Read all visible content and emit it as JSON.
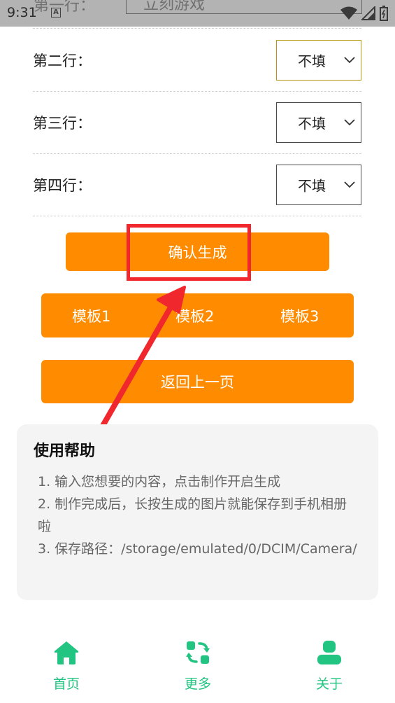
{
  "status_bar": {
    "time": "9:31",
    "notification_glyph": "A"
  },
  "background_row": {
    "label_fragment": "第一行：",
    "value_fragment": "立刻游戏"
  },
  "form": {
    "rows": [
      {
        "label": "第二行：",
        "value": "不填"
      },
      {
        "label": "第三行：",
        "value": "不填"
      },
      {
        "label": "第四行：",
        "value": "不填"
      }
    ]
  },
  "actions": {
    "confirm_label": "确认生成",
    "templates": [
      "模板1",
      "模板2",
      "模板3"
    ],
    "back_label": "返回上一页"
  },
  "help": {
    "title": "使用帮助",
    "items": [
      "1. 输入您想要的内容，点击制作开启生成",
      "2. 制作完成后，长按生成的图片就能保存到手机相册啦",
      "3. 保存路径：/storage/emulated/0/DCIM/Camera/"
    ]
  },
  "bottom_nav": {
    "items": [
      {
        "label": "首页",
        "icon": "home-icon"
      },
      {
        "label": "更多",
        "icon": "refresh-icon"
      },
      {
        "label": "关于",
        "icon": "user-icon"
      }
    ]
  },
  "colors": {
    "accent_orange": "#ff8c00",
    "nav_green": "#21c480",
    "annotation_red": "#f0282e"
  }
}
